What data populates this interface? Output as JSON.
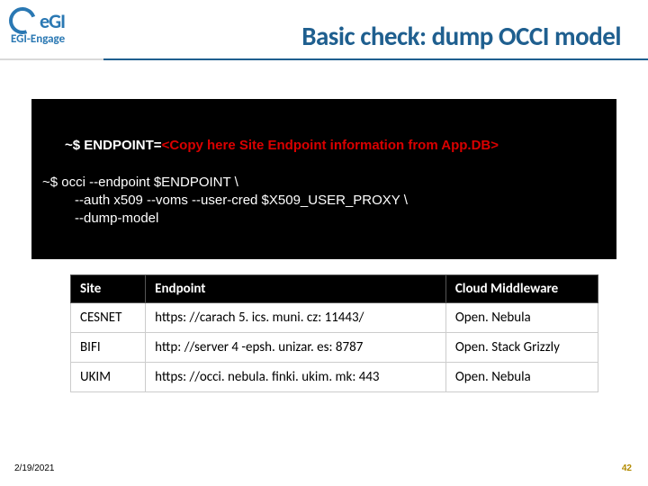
{
  "logo": {
    "brand": "eGI",
    "subtitle": "EGI-Engage"
  },
  "title": "Basic check: dump OCCI model",
  "terminal": {
    "l1_prefix": "~$ ENDPOINT=",
    "l1_param": "<Copy here Site Endpoint information from App.DB>",
    "l2": "~$ occi --endpoint $ENDPOINT \\",
    "l3": "--auth x509 --voms --user-cred $X509_USER_PROXY \\",
    "l4": "--dump-model"
  },
  "table": {
    "headers": [
      "Site",
      "Endpoint",
      "Cloud Middleware"
    ],
    "rows": [
      [
        "CESNET",
        "https: //carach 5. ics. muni. cz: 11443/",
        "Open. Nebula"
      ],
      [
        "BIFI",
        "http: //server 4 -epsh. unizar. es: 8787",
        "Open. Stack Grizzly"
      ],
      [
        "UKIM",
        "https: //occi. nebula. finki. ukim. mk: 443",
        "Open. Nebula"
      ]
    ]
  },
  "footer": {
    "date": "2/19/2021",
    "page": "42"
  }
}
